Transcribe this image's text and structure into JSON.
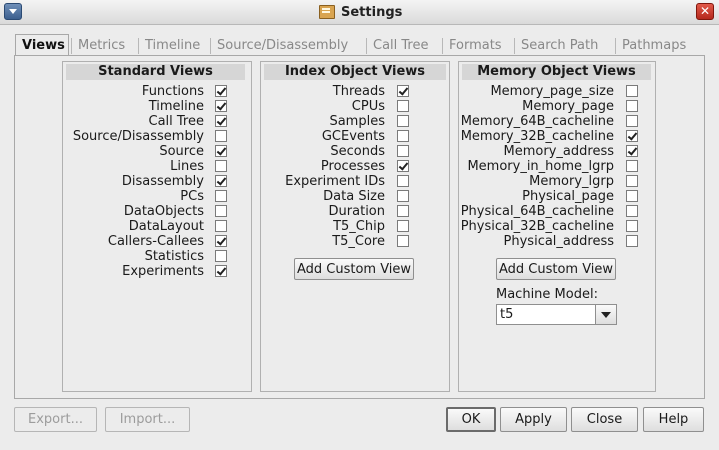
{
  "window": {
    "title": "Settings",
    "close_glyph": "✕"
  },
  "tabs": [
    {
      "label": "Views",
      "active": true
    },
    {
      "label": "Metrics"
    },
    {
      "label": "Timeline"
    },
    {
      "label": "Source/Disassembly"
    },
    {
      "label": "Call Tree"
    },
    {
      "label": "Formats"
    },
    {
      "label": "Search Path"
    },
    {
      "label": "Pathmaps"
    }
  ],
  "standard_views": {
    "title": "Standard Views",
    "items": [
      {
        "label": "Functions",
        "checked": true
      },
      {
        "label": "Timeline",
        "checked": true
      },
      {
        "label": "Call Tree",
        "checked": true
      },
      {
        "label": "Source/Disassembly",
        "checked": false
      },
      {
        "label": "Source",
        "checked": true
      },
      {
        "label": "Lines",
        "checked": false
      },
      {
        "label": "Disassembly",
        "checked": true
      },
      {
        "label": "PCs",
        "checked": false
      },
      {
        "label": "DataObjects",
        "checked": false
      },
      {
        "label": "DataLayout",
        "checked": false
      },
      {
        "label": "Callers-Callees",
        "checked": true
      },
      {
        "label": "Statistics",
        "checked": false
      },
      {
        "label": "Experiments",
        "checked": true
      }
    ]
  },
  "index_views": {
    "title": "Index Object Views",
    "items": [
      {
        "label": "Threads",
        "checked": true
      },
      {
        "label": "CPUs",
        "checked": false
      },
      {
        "label": "Samples",
        "checked": false
      },
      {
        "label": "GCEvents",
        "checked": false
      },
      {
        "label": "Seconds",
        "checked": false
      },
      {
        "label": "Processes",
        "checked": true
      },
      {
        "label": "Experiment IDs",
        "checked": false
      },
      {
        "label": "Data Size",
        "checked": false
      },
      {
        "label": "Duration",
        "checked": false
      },
      {
        "label": "T5_Chip",
        "checked": false
      },
      {
        "label": "T5_Core",
        "checked": false
      }
    ],
    "add_button": "Add Custom View"
  },
  "memory_views": {
    "title": "Memory Object Views",
    "items": [
      {
        "label": "Memory_page_size",
        "checked": false
      },
      {
        "label": "Memory_page",
        "checked": false
      },
      {
        "label": "Memory_64B_cacheline",
        "checked": false
      },
      {
        "label": "Memory_32B_cacheline",
        "checked": true
      },
      {
        "label": "Memory_address",
        "checked": true
      },
      {
        "label": "Memory_in_home_lgrp",
        "checked": false
      },
      {
        "label": "Memory_lgrp",
        "checked": false
      },
      {
        "label": "Physical_page",
        "checked": false
      },
      {
        "label": "Physical_64B_cacheline",
        "checked": false
      },
      {
        "label": "Physical_32B_cacheline",
        "checked": false
      },
      {
        "label": "Physical_address",
        "checked": false
      }
    ],
    "add_button": "Add Custom View",
    "machine_model_label": "Machine Model:",
    "machine_model_value": "t5"
  },
  "footer": {
    "export": "Export...",
    "import": "Import...",
    "ok": "OK",
    "apply": "Apply",
    "close": "Close",
    "help": "Help"
  }
}
